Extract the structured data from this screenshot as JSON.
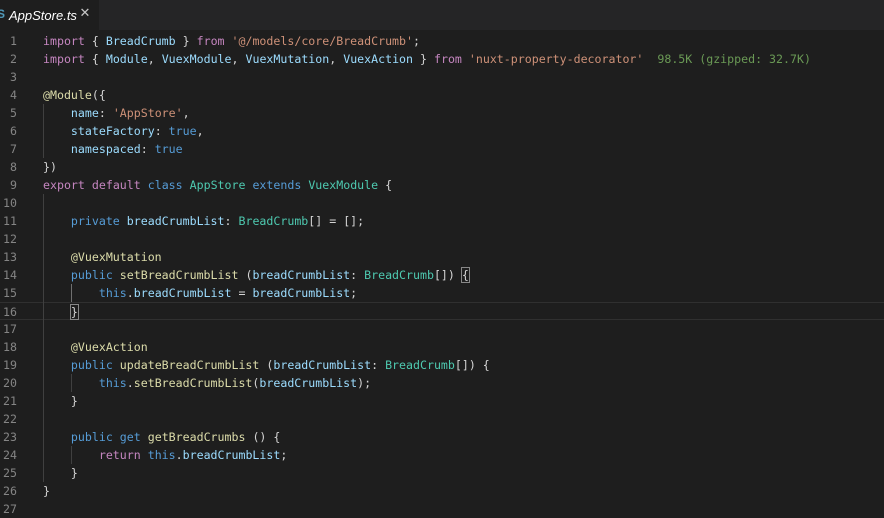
{
  "tab": {
    "lang_label": "S",
    "title": "AppStore.ts",
    "close_label": "✕"
  },
  "editor": {
    "current_line": 16,
    "lines": [
      {
        "n": "1",
        "tokens": [
          [
            "kw",
            "import"
          ],
          [
            "pl",
            " { "
          ],
          [
            "vr",
            "BreadCrumb"
          ],
          [
            "pl",
            " } "
          ],
          [
            "kw",
            "from"
          ],
          [
            "pl",
            " "
          ],
          [
            "st",
            "'@/models/core/BreadCrumb'"
          ],
          [
            "pl",
            ";"
          ]
        ]
      },
      {
        "n": "2",
        "tokens": [
          [
            "kw",
            "import"
          ],
          [
            "pl",
            " { "
          ],
          [
            "vr",
            "Module"
          ],
          [
            "pl",
            ", "
          ],
          [
            "vr",
            "VuexModule"
          ],
          [
            "pl",
            ", "
          ],
          [
            "vr",
            "VuexMutation"
          ],
          [
            "pl",
            ", "
          ],
          [
            "vr",
            "VuexAction"
          ],
          [
            "pl",
            " } "
          ],
          [
            "kw",
            "from"
          ],
          [
            "pl",
            " "
          ],
          [
            "st",
            "'nuxt-property-decorator'"
          ],
          [
            "hint",
            "  98.5K (gzipped: 32.7K)"
          ]
        ]
      },
      {
        "n": "3",
        "tokens": []
      },
      {
        "n": "4",
        "tokens": [
          [
            "fn",
            "@Module"
          ],
          [
            "pl",
            "({"
          ]
        ]
      },
      {
        "n": "5",
        "tokens": [
          [
            "pl",
            "    "
          ],
          [
            "vr",
            "name"
          ],
          [
            "pl",
            ": "
          ],
          [
            "st",
            "'AppStore'"
          ],
          [
            "pl",
            ","
          ]
        ]
      },
      {
        "n": "6",
        "tokens": [
          [
            "pl",
            "    "
          ],
          [
            "vr",
            "stateFactory"
          ],
          [
            "pl",
            ": "
          ],
          [
            "bl",
            "true"
          ],
          [
            "pl",
            ","
          ]
        ]
      },
      {
        "n": "7",
        "tokens": [
          [
            "pl",
            "    "
          ],
          [
            "vr",
            "namespaced"
          ],
          [
            "pl",
            ": "
          ],
          [
            "bl",
            "true"
          ]
        ]
      },
      {
        "n": "8",
        "tokens": [
          [
            "pl",
            "})"
          ]
        ]
      },
      {
        "n": "9",
        "tokens": [
          [
            "kw",
            "export"
          ],
          [
            "pl",
            " "
          ],
          [
            "kw",
            "default"
          ],
          [
            "pl",
            " "
          ],
          [
            "bl",
            "class"
          ],
          [
            "pl",
            " "
          ],
          [
            "cl",
            "AppStore"
          ],
          [
            "pl",
            " "
          ],
          [
            "bl",
            "extends"
          ],
          [
            "pl",
            " "
          ],
          [
            "cl",
            "VuexModule"
          ],
          [
            "pl",
            " {"
          ]
        ]
      },
      {
        "n": "10",
        "tokens": []
      },
      {
        "n": "11",
        "tokens": [
          [
            "pl",
            "    "
          ],
          [
            "bl",
            "private"
          ],
          [
            "pl",
            " "
          ],
          [
            "vr",
            "breadCrumbList"
          ],
          [
            "pl",
            ": "
          ],
          [
            "cl",
            "BreadCrumb"
          ],
          [
            "pl",
            "[] = [];"
          ]
        ]
      },
      {
        "n": "12",
        "tokens": []
      },
      {
        "n": "13",
        "tokens": [
          [
            "pl",
            "    "
          ],
          [
            "fn",
            "@VuexMutation"
          ]
        ]
      },
      {
        "n": "14",
        "tokens": [
          [
            "pl",
            "    "
          ],
          [
            "bl",
            "public"
          ],
          [
            "pl",
            " "
          ],
          [
            "fn",
            "setBreadCrumbList"
          ],
          [
            "pl",
            " ("
          ],
          [
            "vr",
            "breadCrumbList"
          ],
          [
            "pl",
            ": "
          ],
          [
            "cl",
            "BreadCrumb"
          ],
          [
            "pl",
            "[]) "
          ],
          [
            "bm",
            "{"
          ]
        ]
      },
      {
        "n": "15",
        "tokens": [
          [
            "pl",
            "        "
          ],
          [
            "bl",
            "this"
          ],
          [
            "pl",
            "."
          ],
          [
            "vr",
            "breadCrumbList"
          ],
          [
            "pl",
            " = "
          ],
          [
            "vr",
            "breadCrumbList"
          ],
          [
            "pl",
            ";"
          ]
        ]
      },
      {
        "n": "16",
        "tokens": [
          [
            "pl",
            "    "
          ],
          [
            "bm",
            "}"
          ]
        ]
      },
      {
        "n": "17",
        "tokens": []
      },
      {
        "n": "18",
        "tokens": [
          [
            "pl",
            "    "
          ],
          [
            "fn",
            "@VuexAction"
          ]
        ]
      },
      {
        "n": "19",
        "tokens": [
          [
            "pl",
            "    "
          ],
          [
            "bl",
            "public"
          ],
          [
            "pl",
            " "
          ],
          [
            "fn",
            "updateBreadCrumbList"
          ],
          [
            "pl",
            " ("
          ],
          [
            "vr",
            "breadCrumbList"
          ],
          [
            "pl",
            ": "
          ],
          [
            "cl",
            "BreadCrumb"
          ],
          [
            "pl",
            "[]) {"
          ]
        ]
      },
      {
        "n": "20",
        "tokens": [
          [
            "pl",
            "        "
          ],
          [
            "bl",
            "this"
          ],
          [
            "pl",
            "."
          ],
          [
            "fn",
            "setBreadCrumbList"
          ],
          [
            "pl",
            "("
          ],
          [
            "vr",
            "breadCrumbList"
          ],
          [
            "pl",
            ");"
          ]
        ]
      },
      {
        "n": "21",
        "tokens": [
          [
            "pl",
            "    }"
          ]
        ]
      },
      {
        "n": "22",
        "tokens": []
      },
      {
        "n": "23",
        "tokens": [
          [
            "pl",
            "    "
          ],
          [
            "bl",
            "public"
          ],
          [
            "pl",
            " "
          ],
          [
            "bl",
            "get"
          ],
          [
            "pl",
            " "
          ],
          [
            "fn",
            "getBreadCrumbs"
          ],
          [
            "pl",
            " () {"
          ]
        ]
      },
      {
        "n": "24",
        "tokens": [
          [
            "pl",
            "        "
          ],
          [
            "kw",
            "return"
          ],
          [
            "pl",
            " "
          ],
          [
            "bl",
            "this"
          ],
          [
            "pl",
            "."
          ],
          [
            "vr",
            "breadCrumbList"
          ],
          [
            "pl",
            ";"
          ]
        ]
      },
      {
        "n": "25",
        "tokens": [
          [
            "pl",
            "    }"
          ]
        ]
      },
      {
        "n": "26",
        "tokens": [
          [
            "pl",
            "}"
          ]
        ]
      },
      {
        "n": "27",
        "tokens": []
      }
    ]
  }
}
